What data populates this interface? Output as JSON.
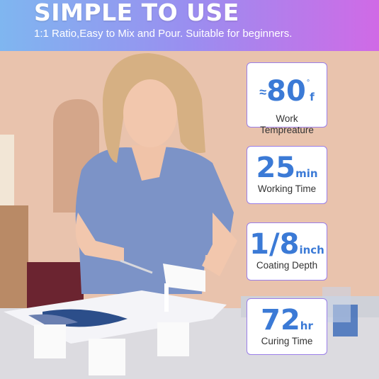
{
  "header": {
    "headline": "SIMPLE TO USE",
    "subline": "1:1 Ratio,Easy to Mix and Pour. Suitable for beginners."
  },
  "stats": [
    {
      "prefix": "≈",
      "value": "80",
      "degree": "°",
      "unit": "f",
      "label_line1": "Work",
      "label_line2": "Tempreature"
    },
    {
      "value": "25",
      "unit": "min",
      "label": "Working Time"
    },
    {
      "value": "1/8",
      "unit": "inch",
      "label": "Coating Depth"
    },
    {
      "value": "72",
      "unit": "hr",
      "label": "Curing Time"
    }
  ],
  "colors": {
    "accent": "#3b7ad6",
    "card_border": "#9a7ee8",
    "banner_start": "#7fb6f0",
    "banner_end": "#d06ae6"
  }
}
